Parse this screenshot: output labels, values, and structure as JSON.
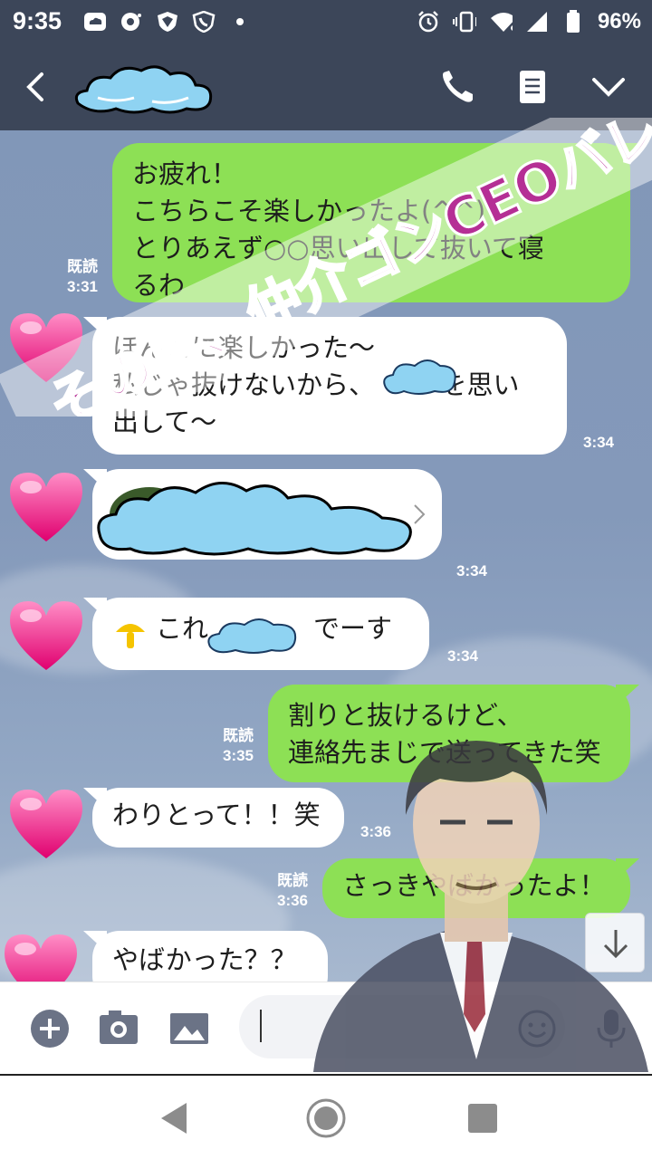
{
  "status_bar": {
    "time": "9:35",
    "battery": "96%",
    "icons_left": [
      "cloud-app-icon",
      "podcast-icon",
      "shield-icon",
      "phone-shield-icon",
      "dot-icon"
    ],
    "icons_right": [
      "alarm-icon",
      "vibrate-icon",
      "wifi-icon",
      "signal-icon",
      "battery-icon"
    ]
  },
  "header": {
    "contact_name_hidden": true,
    "buttons": [
      "back-icon",
      "call-icon",
      "notes-icon",
      "chevron-down-icon"
    ]
  },
  "messages": [
    {
      "dir": "out",
      "lines": [
        "お疲れ！",
        "こちらこそ楽しかったよ(^^)",
        "とりあえず○○思い出して抜いて寝",
        "るわ"
      ],
      "read": "既読",
      "time": "3:31"
    },
    {
      "dir": "in",
      "lines": [
        "ほんとに楽しかった〜",
        "私じゃ抜けないから、　　　を思い",
        "出して〜"
      ],
      "time": "3:34"
    },
    {
      "dir": "in",
      "type": "link-card",
      "time": "3:34"
    },
    {
      "dir": "in",
      "lines": [
        "これ　　　　でーす"
      ],
      "time": "3:34"
    },
    {
      "dir": "out",
      "lines": [
        "割りと抜けるけど、",
        "連絡先まじで送ってきた笑"
      ],
      "read": "既読",
      "time": "3:35"
    },
    {
      "dir": "in",
      "lines": [
        "わりとって！！笑"
      ],
      "time": "3:36"
    },
    {
      "dir": "out",
      "lines": [
        "さっきやばかったよ！"
      ],
      "read": "既読",
      "time": "3:36"
    },
    {
      "dir": "in",
      "lines": [
        "やばかった？？"
      ]
    }
  ],
  "input": {
    "placeholder": ""
  },
  "watermark": {
    "text": "その男、仲介ゴンCEOバレつき。"
  },
  "colors": {
    "header": "#3c4659",
    "chat_bg": "#8499ba",
    "out_bubble": "#8de055",
    "in_bubble": "#ffffff"
  }
}
